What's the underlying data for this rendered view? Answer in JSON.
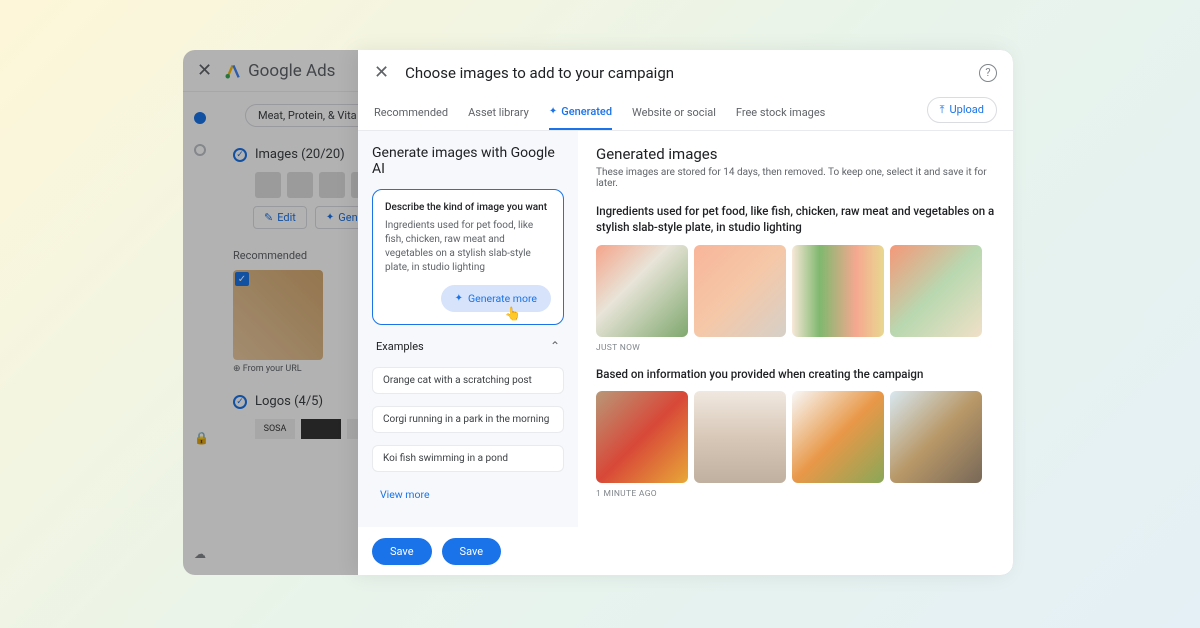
{
  "bg": {
    "app_name": "Google Ads",
    "chip": "Meat, Protein, & Vita",
    "images_title": "Images (20/20)",
    "edit_label": "Edit",
    "gen_label": "Gen",
    "recommended": "Recommended",
    "from_url": "From your URL",
    "logos_title": "Logos (4/5)",
    "logo_text": "SOSA"
  },
  "modal": {
    "title": "Choose images to add to your campaign",
    "upload": "Upload",
    "tabs": {
      "recommended": "Recommended",
      "asset_library": "Asset library",
      "generated": "Generated",
      "website": "Website or social",
      "free_stock": "Free stock images"
    }
  },
  "left": {
    "title": "Generate images with Google AI",
    "prompt_label": "Describe the kind of image you want",
    "prompt_text": "Ingredients used for pet food, like fish, chicken, raw meat and vegetables on a stylish slab-style plate, in studio lighting",
    "generate_more": "Generate more",
    "examples_label": "Examples",
    "examples": [
      "Orange cat with a scratching post",
      "Corgi running in a park in the morning",
      "Koi fish swimming in a pond"
    ],
    "view_more": "View more"
  },
  "right": {
    "title": "Generated images",
    "subtitle": "These images are stored for 14 days, then removed. To keep one, select it and save it for later.",
    "prompt_echo": "Ingredients used for pet food, like fish, chicken, raw meat and vegetables on a stylish slab-style plate, in studio lighting",
    "timestamp1": "Just now",
    "heading2": "Based on information you provided when creating the campaign",
    "timestamp2": "1 minute ago"
  },
  "footer": {
    "save1": "Save",
    "save2": "Save"
  }
}
